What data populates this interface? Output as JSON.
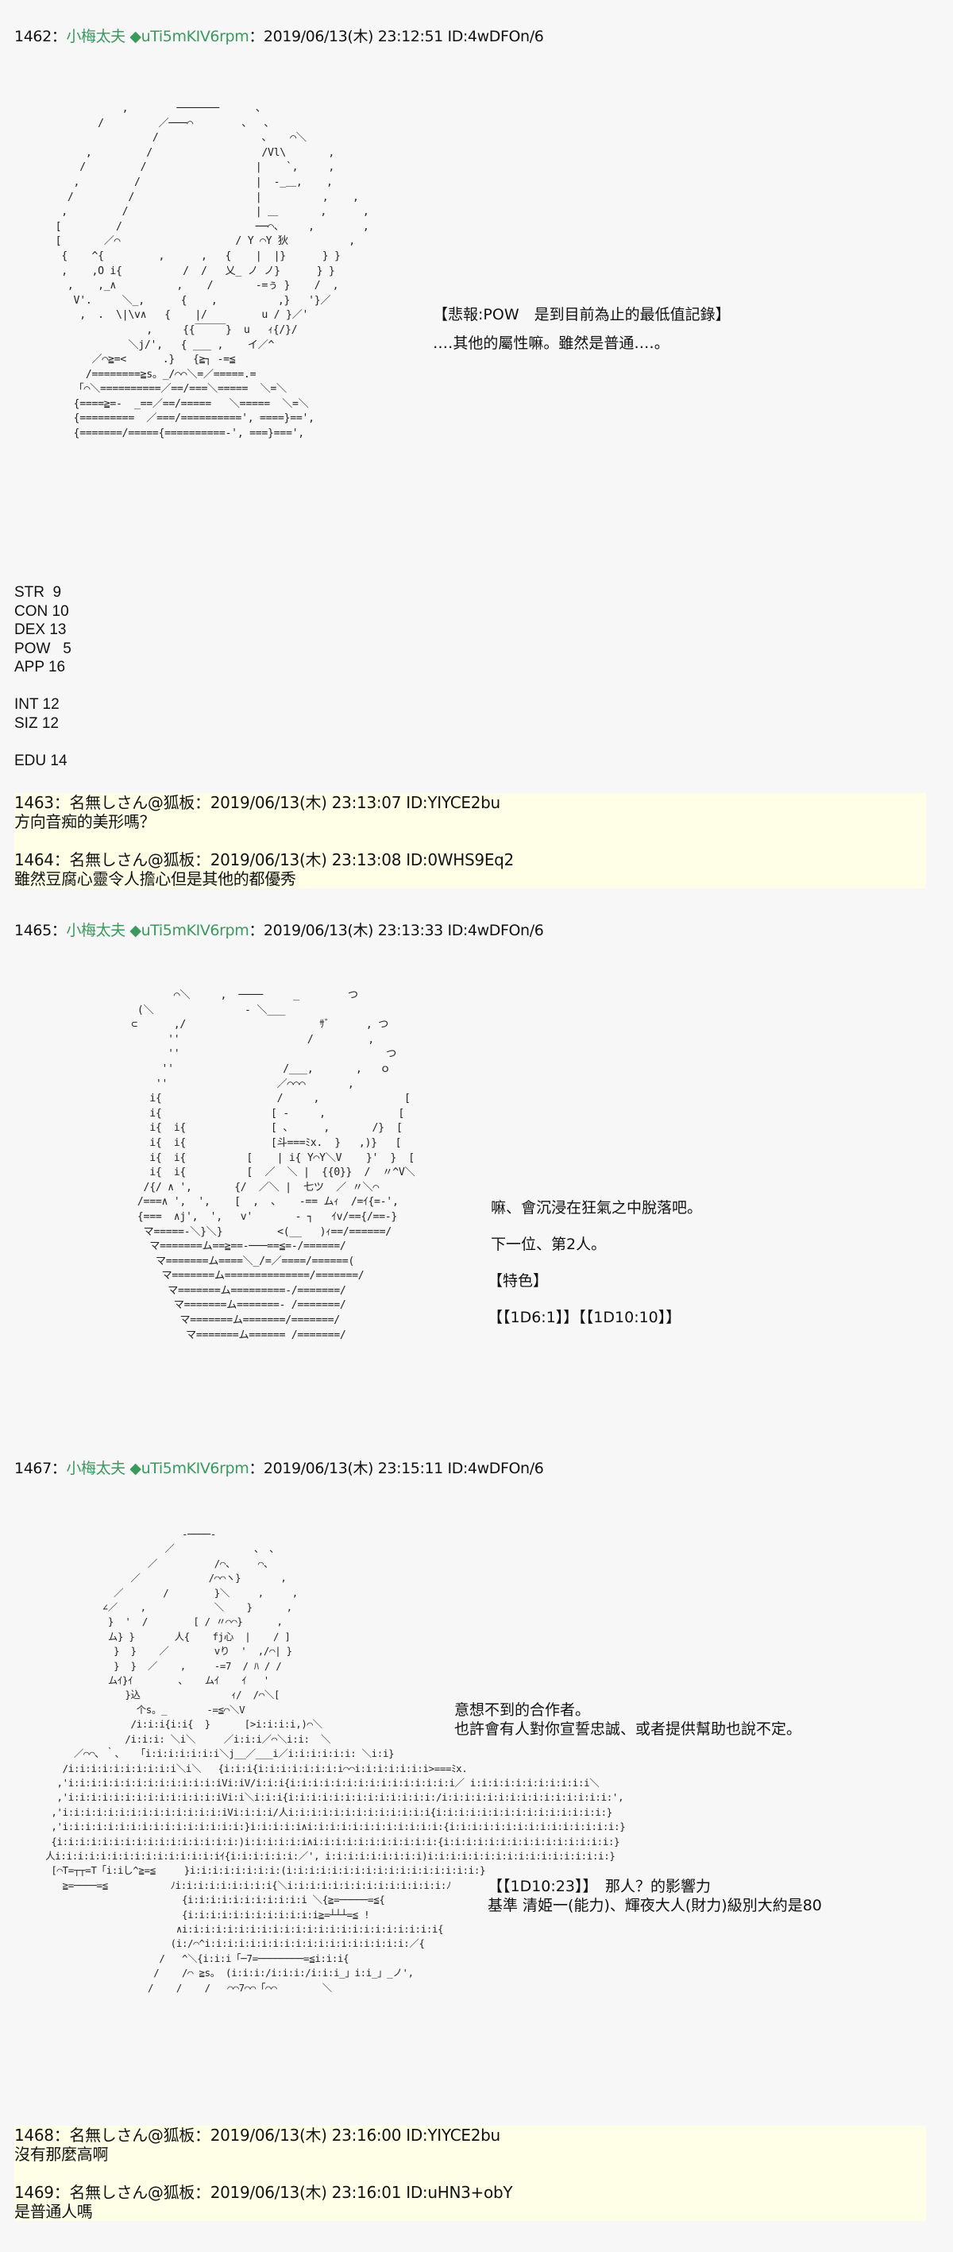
{
  "posts": [
    {
      "number": "1462",
      "name": "小梅太夫",
      "trip": "◆uTi5mKIV6rpm",
      "date": "2019/06/13(木) 23:12:51",
      "id": "ID:4wDFOn/6",
      "side_text": [
        "【悲報:POW　是到目前為止的最低值記錄】",
        "‥‥其他的屬性嘛。雖然是普通‥‥。"
      ],
      "stats": "STR  9\nCON 10\nDEX 13\nPOW   5\nAPP 16\n\nINT 12\nSIZ 12\n\nEDU 14"
    },
    {
      "number": "1465",
      "name": "小梅太夫",
      "trip": "◆uTi5mKIV6rpm",
      "date": "2019/06/13(木) 23:13:33",
      "id": "ID:4wDFOn/6",
      "side_text": [
        "嘛、會沉浸在狂氣之中脫落吧。",
        "下一位、第2人。",
        "【特色】",
        "【【1D6:1】】【【1D10:10】】"
      ]
    },
    {
      "number": "1467",
      "name": "小梅太夫",
      "trip": "◆uTi5mKIV6rpm",
      "date": "2019/06/13(木) 23:15:11",
      "id": "ID:4wDFOn/6",
      "side_text": [
        "意想不到的合作者。",
        "也許會有人對你宣誓忠誠、或者提供幫助也說不定。",
        "【【1D10:23】】　那人？的影響力",
        "基準 清姫一(能力)、輝夜大人(財力)級別大約是80"
      ]
    }
  ],
  "replies_group_1": [
    {
      "header": "1463：名無しさん@狐板：2019/06/13(木) 23:13:07 ID:YIYCE2bu",
      "body": "方向音痴的美形嗎？"
    },
    {
      "header": "1464：名無しさん@狐板：2019/06/13(木) 23:13:08 ID:0WHS9Eq2",
      "body": "雖然豆腐心靈令人擔心但是其他的都優秀"
    }
  ],
  "replies_group_2": [
    {
      "header": "1468：名無しさん@狐板：2019/06/13(木) 23:16:00 ID:YIYCE2bu",
      "body": "沒有那麼高啊"
    },
    {
      "header": "1469：名無しさん@狐板：2019/06/13(木) 23:16:01 ID:uHN3+obY",
      "body": "是普通人嗎"
    }
  ],
  "separator": "：",
  "aa": {
    "art1": "            ,        ───────      、\n        /         ／───⌒        、  、\n                 /                 、   ⌒＼\n      ,         /                  /Vl\\       ,\n     /         /                  |    `,     ,\n    ,         /                   |  ‐_＿,    ,\n   /         /                    |          ,    ,\n  ,         /                     | ＿       ,      ,\n [         /                      ──⌒、    ,        ,\n [       ／⌒                   / Y ⌒Y 狄          ,\n  {    ^{         ,      ,   {    |  |}      } }\n  ,    ,O i{          /  /   乂_ ノ ノ}      } }\n   ,    ,_∧          ,    /       ‐=ぅ }    /  ,\n    V'.     ＼_,      {    ,          ,}   '}／\n     ,  .  \\|\\v∧   {    |/         u / }／'\n                ,     {{￣￣￣}  u   ｨ{/}/\n             ＼j/',   { ___ ,    イ／^\n       ／⌒≧=<      .}   {≧┐ ‐=≦\n      /========≧s。_/⌒⌒＼=／=====.=\n    「⌒＼==========／==/===＼=====  ＼=＼\n    {====≧=‐  _==／==/=====   ＼=====  ＼=＼\n    {=========  ／===/==========', ====}==',\n    {=======/====={==========‐', ===}===',",
    "art2": "         ⌒＼     ,  ────     _        つ\n   (＼               ‐ ＼___     \n  ⊂      ,/                      ｻﾞ      , つ\n        ''                     /         ,\n        ''                                  つ\n       ''                  /___,       ,   ｏ\n      ''                  ／⌒⌒⌒       ,\n     i{                   /     ,              [\n     i{                  [ ‐     ,            [\n     i{  i{              [ 、     ,       /}  [\n     i{  i{              [斗===ﾐx.  }   ,)}   [\n     i{  i{          [    | i{ Y⌒Y＼V    }'  }  [\n     i{  i{          [  ／  ＼ |  {{0}}  /  〃^V＼ \n    /{/ ∧ ',       {/  ／＼ |  七ツ  ／ 〃＼⌒\n   /===∧ ',  ',    [  ,  、   ‐== ムｨ  /=ｲ{=‐',\n   {===  ∧j',  ',   v'       ‐ ┐   ｲv/=={/==‐}\n    マ=====‐＼}＼}         <(__   )ｨ==/======/\n     マ=======ム==≧==‐───==≦=‐/======/\n      マ=======ム====＼_/=／====/======(\n       マ=======ム==============/=======/\n        マ=======ム=========‐/=======/\n         マ=======ム=======‐ /=======/\n          マ=======ム=======/=======/\n           マ=======ム====== /=======/",
    "art3": "                         -────-\n                      ／              、 、\n                   ／          /⌒、    ⌒、\n                ／            /⌒⌒ヽ}       ,\n             ／       /        }＼     ,     ,\n           ∠／    ,            ＼    }      ,\n            }  '  /        [ / 〃⌒⌒}      ,\n            ム} }       人{    fj心  |    / ]\n             }  }    ／        vり  '  ,/⌒| }\n             }  }  ／    ,     ‐=7  / ﾊ / /\n            ムｲ}ｲ        、   ムｲ    ｲ   '\n               }込                ｨ/  /⌒＼[\n                 个s。_       ‐=≦⌒＼V\n                /i:i:i{i:i{  }      [>i:i:i:i,)⌒＼\n               /i:i:i: ＼i＼     ／i:i:i／⌒＼i:i:  ＼\n      ／⌒⌒､ ｀、  「i:i:i:i:i:i:i＼j__／___i／i:i:i:i:i:i: ＼i:i}\n    /i:i:i:i:i:i:i:i:i:i＼i＼   {i:i:i{i:i:i:i:i:i:i:i⌒⌒i:i:i:i:i:i:i>===ﾐx.\n   ,'i:i:i:i:i:i:i:i:i:i:i:i:i:iVi:iV/i:i:i{i:i:i:i:i:i:i:i:i:i:i:i:i:i:i／ i:i:i:i:i:i:i:i:i:i:i＼\n   ,'i:i:i:i:i:i:i:i:i:i:i:i:i:iVi:i＼i:i:i{i:i:i:i:i:i:i:i:i:i:i:i:i:/i:i:i:i:i:i:i:i:i:i:i:i:i:i:i:',\n  ,'i:i:i:i:i:i:i:i:i:i:i:i:i:i:iVi:i:i:i/人i:i:i:i:i:i:i:i:i:i:i:i:i{i:i:i:i:i:i:i:i:i:i:i:i:i:i:i:}\n  ,'i:i:i:i:i:i:i:i:i:i:i:i:i:i:i:i:}i:i:i:i:i∧i:i:i:i:i:i:i:i:i:i:i:i:{i:i:i:i:i:i:i:i:i:i:i:i:i:i:i:}\n  {i:i:i:i:i:i:i:i:i:i:i:i:i:i:i:i:)i:i:i:i:i:i∧i:i:i:i:i:i:i:i:i:i:i:{i:i:i:i:i:i:i:i:i:i:i:i:i:i:i:}\n 人i:i:i:i:i:i:i:i:i:i:i:i:i:i:iｲ{i:i:i:i:i:i:／', i:i:i:i:i:i:i:i:i)i:i:i:i:i:i:i:i:i:i:i:i:i:i:i:i:}\n  [⌒T=┬┬=T「i:iし^≧=≦     }i:i:i:i:i:i:i:i:(i:i:i:i:i:i:i:i:i:i:i:i:i:i:i:i:i:}\n    ≧=────=≦           ﾉi:i:i:i:i:i:i:i:i{＼i:i:i:i:i:i:i:i:i:i:i:i:i:i:ﾉ\n                         {i:i:i:i:i:i:i:i:i:i:i ＼{≧=─────=≦{\n                         {i:i:i:i:i:i:i:i:i:i:i:i≧=┴┴┴=≦ !\n                        ∧i:i:i:i:i:i:i:i:i:i:i:i:i:i:i:i:i:i:i:i:i:i:i{\n                       (i:/⌒^i:i:i:i:i:i:i:i:i:i:i:i:i:i:i:i:i:i:／{\n                     /   ^＼{i:i:i「─7=────────=≦i:i:i{\n                    /    /⌒ ≧s。 (i:i:i:/i:i:i:/i:i:i_」i:i_」_ノ',\n                   /    /    /   ⌒⌒7⌒⌒「⌒⌒        ＼"
  }
}
